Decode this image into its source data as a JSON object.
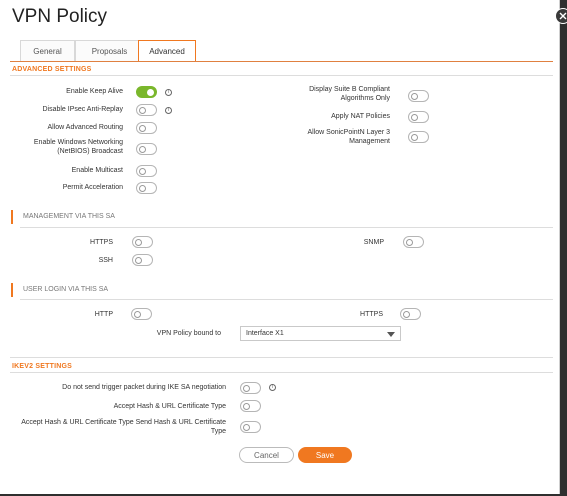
{
  "dialog": {
    "title": "VPN Policy"
  },
  "tabs": [
    {
      "label": "General"
    },
    {
      "label": "Proposals"
    },
    {
      "label": "Advanced"
    }
  ],
  "advanced_settings": {
    "title": "ADVANCED SETTINGS",
    "left": [
      {
        "label": "Enable Keep Alive",
        "on": true,
        "info": true
      },
      {
        "label": "Disable IPsec Anti-Replay",
        "on": false,
        "info": true
      },
      {
        "label": "Allow Advanced Routing",
        "on": false
      },
      {
        "label_line1": "Enable Windows Networking",
        "label_line2": "(NetBIOS) Broadcast",
        "on": false
      },
      {
        "label": "Enable Multicast",
        "on": false
      },
      {
        "label": "Permit Acceleration",
        "on": false
      }
    ],
    "right": [
      {
        "label_line1": "Display Suite B Compliant",
        "label_line2": "Algorithms Only",
        "on": false
      },
      {
        "label": "Apply NAT Policies",
        "on": false
      },
      {
        "label_line1": "Allow SonicPointN Layer 3",
        "label_line2": "Management",
        "on": false
      }
    ]
  },
  "management": {
    "title": "MANAGEMENT VIA THIS SA",
    "https": "HTTPS",
    "ssh": "SSH",
    "snmp": "SNMP"
  },
  "user_login": {
    "title": "USER LOGIN VIA THIS SA",
    "http": "HTTP",
    "https": "HTTPS",
    "bound_label": "VPN Policy bound to",
    "bound_value": "Interface X1"
  },
  "ikev2": {
    "title": "IKEV2 SETTINGS",
    "no_trigger": "Do not send trigger packet during IKE SA negotiation",
    "accept_hash": "Accept Hash & URL Certificate Type",
    "send_hash_line1": "Accept Hash & URL Certificate Type Send Hash & URL Certificate",
    "send_hash_line2": "Type"
  },
  "buttons": {
    "cancel": "Cancel",
    "save": "Save"
  },
  "colors": {
    "accent": "#f07820",
    "toggle_on": "#7ab72c"
  },
  "icons": {
    "info": "info-icon",
    "close": "close-icon",
    "dropdown": "chevron-down-icon"
  }
}
